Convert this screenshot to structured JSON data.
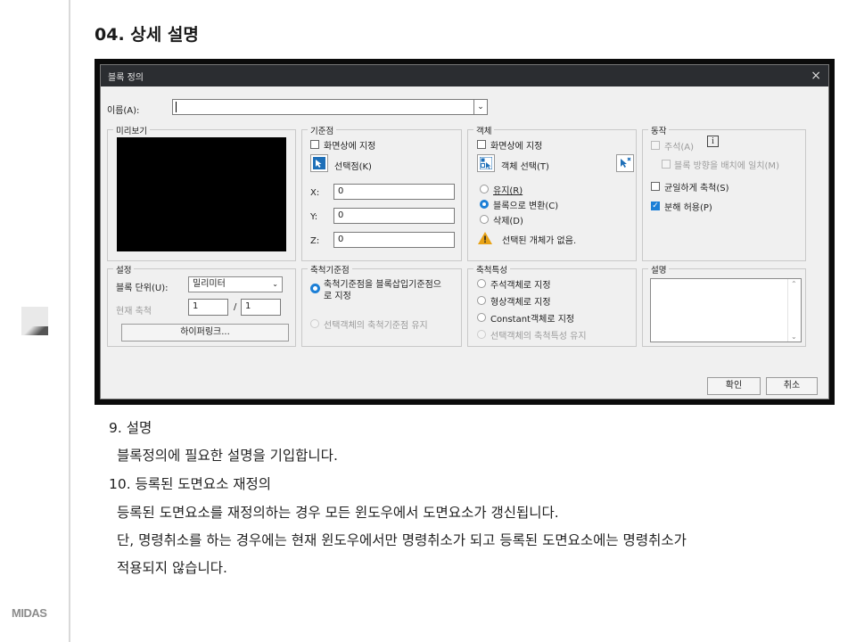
{
  "section_title": "04. 상세 설명",
  "logo_text": "MIDAS",
  "dialog": {
    "title": "블록 정의",
    "close_glyph": "×",
    "name_label": "이름(A):",
    "name_value": "",
    "preview_group": "미리보기",
    "base_group": {
      "title": "기준점",
      "specify_on_screen": "화면상에 지정",
      "pick_point": "선택점(K)",
      "x_label": "X:",
      "x_value": "0",
      "y_label": "Y:",
      "y_value": "0",
      "z_label": "Z:",
      "z_value": "0"
    },
    "object_group": {
      "title": "객체",
      "specify_on_screen": "화면상에 지정",
      "select_objects": "객체 선택(T)",
      "retain": "유지(R)",
      "convert": "블록으로 변환(C)",
      "delete": "삭제(D)",
      "warning": "선택된 개체가 없음."
    },
    "behavior_group": {
      "title": "동작",
      "annotative": "주석(A)",
      "match_orientation": "블록 방향을 배치에 일치(M)",
      "scale_uniformly": "균일하게 축척(S)",
      "allow_explode": "분해 허용(P)",
      "allow_explode_checked": true
    },
    "settings_group": {
      "title": "설정",
      "unit_label": "블록 단위(U):",
      "unit_value": "밀리미터",
      "scale_label": "현재 축척",
      "scale_num": "1",
      "scale_sep": "/",
      "scale_den": "1",
      "hyperlink_button": "하이퍼링크..."
    },
    "scale_base_group": {
      "title": "축척기준점",
      "opt1_line1": "축척기준점을 블록삽입기준점으",
      "opt1_line2": "로 지정",
      "opt2": "선택객체의 축척기준점 유지"
    },
    "scale_prop_group": {
      "title": "축척특성",
      "opt1": "주석객체로 지정",
      "opt2": "형상객체로 지정",
      "opt3": "Constant객체로 지정",
      "opt4": "선택객체의 축척특성 유지"
    },
    "description_group": {
      "title": "설명",
      "value": ""
    },
    "ok_button": "확인",
    "cancel_button": "취소"
  },
  "body": {
    "item9_heading": "9. 설명",
    "item9_text": "블록정의에 필요한 설명을 기입합니다.",
    "item10_heading": "10. 등록된 도면요소 재정의",
    "item10_line1": "등록된 도면요소를 재정의하는 경우 모든 윈도우에서 도면요소가 갱신됩니다.",
    "item10_line2": "단, 명령취소를 하는 경우에는 현재 윈도우에서만 명령취소가 되고 등록된 도면요소에는 명령취소가",
    "item10_line3": "적용되지 않습니다."
  }
}
